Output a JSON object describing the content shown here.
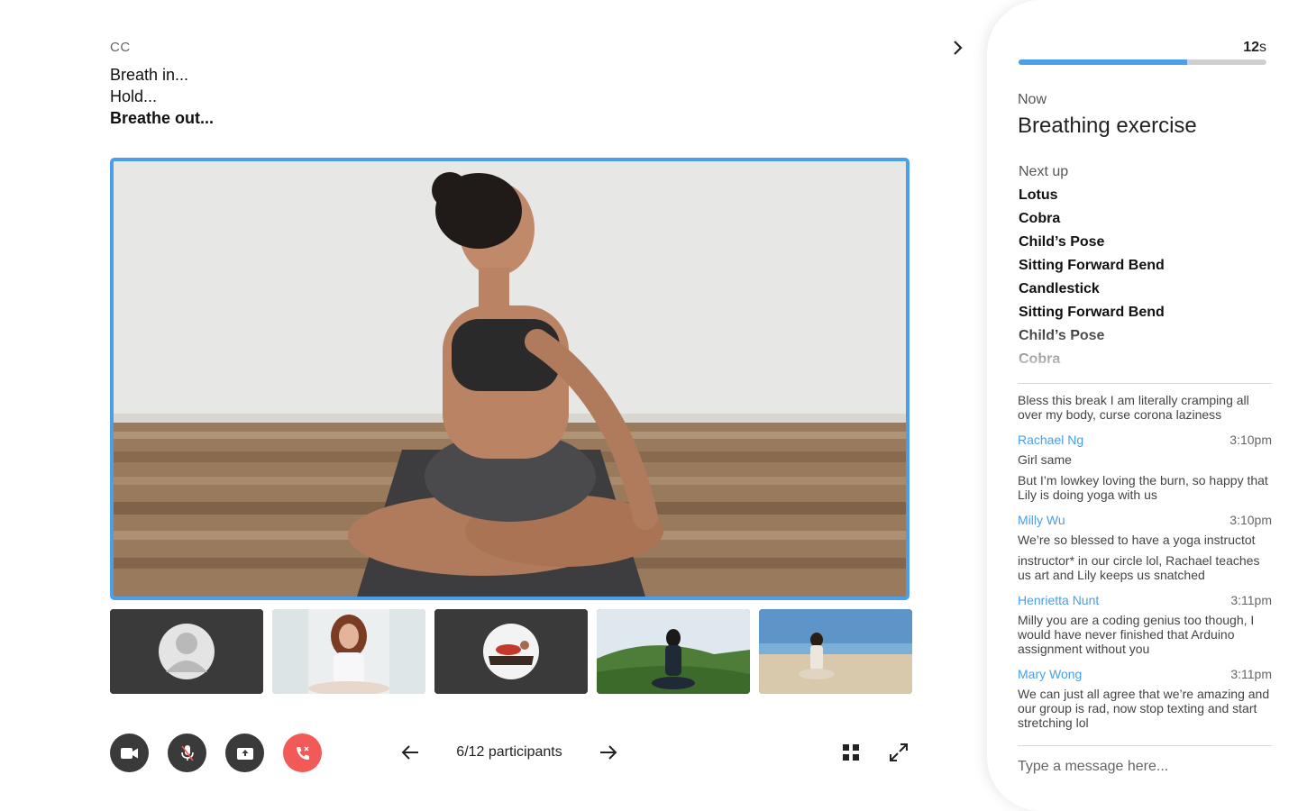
{
  "captions": {
    "label": "CC",
    "lines": [
      "Breath in...",
      "Hold...",
      "Breathe out..."
    ]
  },
  "participants": {
    "pager_text": "6/12 participants"
  },
  "timer": {
    "value": "12",
    "unit": "s",
    "progress_fraction": 0.68
  },
  "session": {
    "now_label": "Now",
    "now_title": "Breathing exercise",
    "next_label": "Next up",
    "next_items": [
      "Lotus",
      "Cobra",
      "Child’s Pose",
      "Sitting Forward Bend",
      "Candlestick",
      "Sitting Forward Bend",
      "Child’s Pose",
      "Cobra"
    ]
  },
  "chat": {
    "messages": [
      {
        "author": "",
        "time": "",
        "texts": [
          "Bless this break I am literally cramping all over my body, curse corona laziness"
        ]
      },
      {
        "author": "Rachael Ng",
        "time": "3:10pm",
        "texts": [
          "Girl same",
          "But I’m lowkey loving the burn, so happy that Lily is doing yoga with us"
        ]
      },
      {
        "author": "Milly Wu",
        "time": "3:10pm",
        "texts": [
          "We’re so blessed to have a yoga instructot",
          "instructor* in our circle lol, Rachael teaches us art and Lily keeps us snatched"
        ]
      },
      {
        "author": "Henrietta Nunt",
        "time": "3:11pm",
        "texts": [
          "Milly you are a coding genius too though, I would have never finished that Arduino assignment without you"
        ]
      },
      {
        "author": "Mary Wong",
        "time": "3:11pm",
        "texts": [
          "We can just all agree that we’re amazing and our group is rad, now stop texting and start stretching lol"
        ]
      }
    ],
    "input_placeholder": "Type a message here..."
  },
  "colors": {
    "accent": "#4a9eea",
    "end_call": "#f25a5a",
    "control_bg": "#3a3a3a"
  }
}
